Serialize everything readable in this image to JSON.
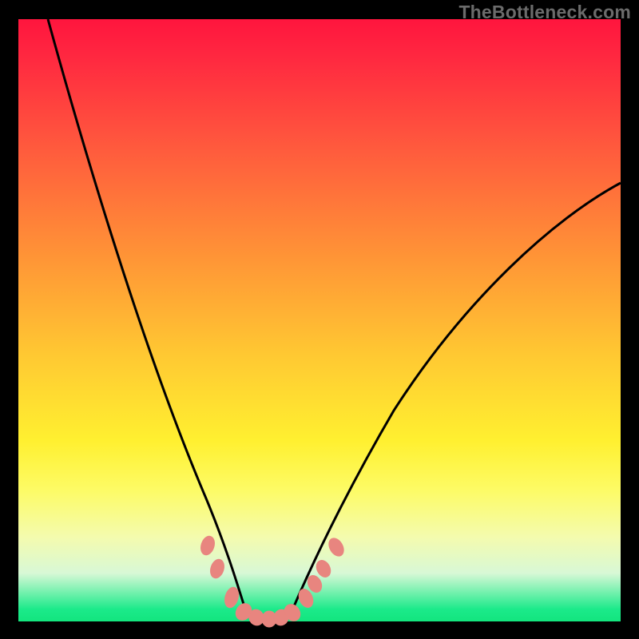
{
  "attribution": "TheBottleneck.com",
  "chart_data": {
    "type": "line",
    "title": "",
    "xlabel": "",
    "ylabel": "",
    "xlim": [
      0,
      100
    ],
    "ylim": [
      0,
      100
    ],
    "grid": false,
    "legend": false,
    "gradient_stops": [
      {
        "pct": 0,
        "color": "#ff153e"
      },
      {
        "pct": 6,
        "color": "#ff2740"
      },
      {
        "pct": 22,
        "color": "#ff5c3d"
      },
      {
        "pct": 40,
        "color": "#ff9636"
      },
      {
        "pct": 56,
        "color": "#ffc932"
      },
      {
        "pct": 70,
        "color": "#fff030"
      },
      {
        "pct": 78,
        "color": "#fdfb64"
      },
      {
        "pct": 86,
        "color": "#f4fbae"
      },
      {
        "pct": 92,
        "color": "#d8f8d6"
      },
      {
        "pct": 98,
        "color": "#1bea8a"
      },
      {
        "pct": 100,
        "color": "#13e57e"
      }
    ],
    "series": [
      {
        "name": "left-branch",
        "x": [
          5.0,
          8.0,
          12.0,
          16.0,
          20.0,
          24.0,
          27.0,
          30.0,
          32.5,
          34.5,
          36.0,
          37.0
        ],
        "y": [
          100.0,
          88.0,
          73.0,
          58.0,
          44.0,
          31.0,
          22.0,
          14.0,
          8.0,
          4.0,
          1.5,
          0.5
        ]
      },
      {
        "name": "valley-floor",
        "x": [
          37.0,
          39.0,
          41.0,
          43.0,
          45.0
        ],
        "y": [
          0.5,
          0.0,
          0.0,
          0.0,
          0.5
        ]
      },
      {
        "name": "right-branch",
        "x": [
          45.0,
          47.0,
          50.0,
          54.0,
          59.0,
          65.0,
          72.0,
          80.0,
          88.0,
          95.0,
          100.0
        ],
        "y": [
          0.5,
          2.0,
          6.0,
          13.0,
          23.0,
          34.0,
          45.0,
          55.0,
          63.0,
          69.0,
          73.0
        ]
      }
    ],
    "markers": {
      "name": "highlight-beads",
      "color": "#e8857f",
      "points": [
        {
          "x": 31.0,
          "y": 12.0
        },
        {
          "x": 32.5,
          "y": 8.0
        },
        {
          "x": 35.0,
          "y": 3.0
        },
        {
          "x": 37.0,
          "y": 0.8
        },
        {
          "x": 39.0,
          "y": 0.3
        },
        {
          "x": 41.0,
          "y": 0.2
        },
        {
          "x": 43.0,
          "y": 0.3
        },
        {
          "x": 45.0,
          "y": 0.8
        },
        {
          "x": 47.5,
          "y": 3.0
        },
        {
          "x": 49.0,
          "y": 5.0
        },
        {
          "x": 50.5,
          "y": 7.5
        },
        {
          "x": 52.5,
          "y": 11.0
        }
      ]
    }
  }
}
